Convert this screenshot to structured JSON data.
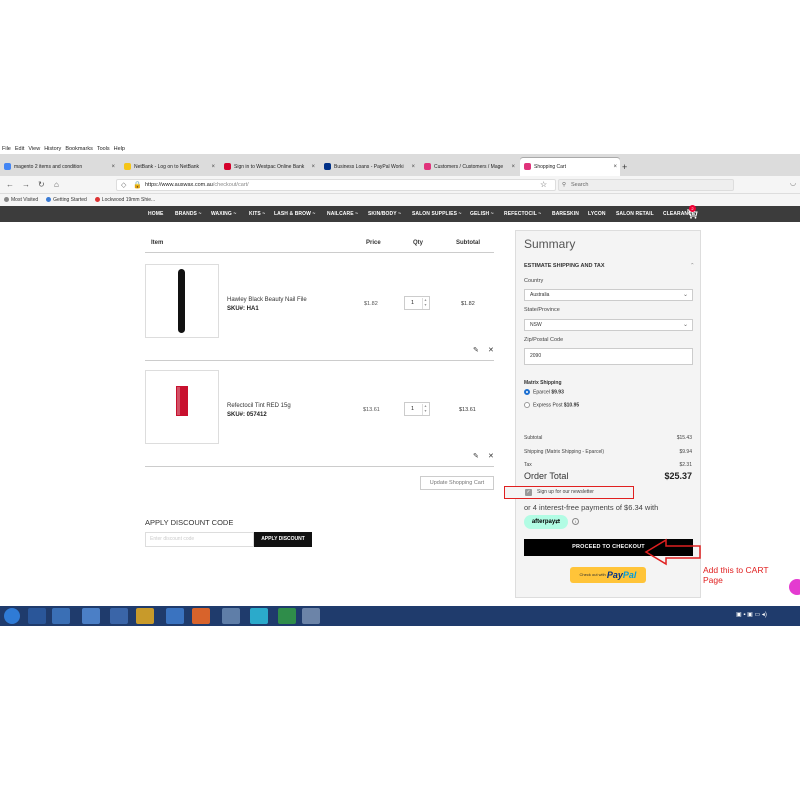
{
  "menu": [
    "File",
    "Edit",
    "View",
    "History",
    "Bookmarks",
    "Tools",
    "Help"
  ],
  "tabs": [
    {
      "label": "magento 2 items and condition",
      "color": "#4285f4"
    },
    {
      "label": "NetBank - Log on to NetBank",
      "color": "#f5c518"
    },
    {
      "label": "Sign in to Westpac Online Bank",
      "color": "#d5002b"
    },
    {
      "label": "Business Loans - PayPal Worki",
      "color": "#003087"
    },
    {
      "label": "Customers / Customers / Mage",
      "color": "#e0337b"
    },
    {
      "label": "Shopping Cart",
      "color": "#e0337b"
    }
  ],
  "nav": {
    "url_host": "https://www.auswax.com.au",
    "url_path": "/checkout/cart/",
    "search_placeholder": "Search"
  },
  "bookmarks": [
    "Most Visited",
    "Getting Started",
    "Lockwood 19mm Shie..."
  ],
  "site_nav": [
    "HOME",
    "BRANDS ~",
    "WAXING ~",
    "KITS ~",
    "LASH & BROW ~",
    "NAILCARE ~",
    "SKIN/BODY ~",
    "SALON SUPPLIES ~",
    "GELISH ~",
    "REFECTOCIL ~",
    "BARESKIN",
    "LYCON",
    "SALON RETAIL",
    "CLEARANCE"
  ],
  "cart_badge": "2",
  "cart": {
    "headers": {
      "item": "Item",
      "price": "Price",
      "qty": "Qty",
      "subtotal": "Subtotal"
    },
    "items": [
      {
        "name": "Hawley Black Beauty Nail File",
        "sku": "SKU#: HA1",
        "price": "$1.82",
        "qty": "1",
        "subtotal": "$1.82"
      },
      {
        "name": "Refectocil Tint RED 15g",
        "sku": "SKU#: 057412",
        "price": "$13.61",
        "qty": "1",
        "subtotal": "$13.61"
      }
    ],
    "update_label": "Update Shopping Cart",
    "discount_title": "APPLY DISCOUNT CODE",
    "discount_placeholder": "Enter discount code",
    "discount_button": "APPLY DISCOUNT"
  },
  "summary": {
    "title": "Summary",
    "estimate_label": "ESTIMATE SHIPPING AND TAX",
    "country_label": "Country",
    "country_value": "Australia",
    "state_label": "State/Province",
    "state_value": "NSW",
    "zip_label": "Zip/Postal Code",
    "zip_value": "2090",
    "shipping_method_title": "Matrix Shipping",
    "options": [
      {
        "name": "Eparcel",
        "price": "$9.93",
        "selected": true
      },
      {
        "name": "Express Post",
        "price": "$10.95",
        "selected": false
      }
    ],
    "totals": [
      {
        "label": "Subtotal",
        "value": "$15.43"
      },
      {
        "label": "Shipping (Matrix Shipping - Eparcel)",
        "value": "$9.94"
      },
      {
        "label": "Tax",
        "value": "$2.31"
      }
    ],
    "order_total_label": "Order Total",
    "order_total_value": "$25.37",
    "newsletter_label": "Sign up for our newsletter",
    "afterpay_text": "or 4 interest-free payments of $6.34 with",
    "afterpay_logo": "afterpay",
    "checkout_label": "PROCEED TO CHECKOUT",
    "paypal_prefix": "Check out with",
    "paypal_logo_a": "Pay",
    "paypal_logo_b": "Pal"
  },
  "annotation": {
    "line1": "Add this to CART",
    "line2": "Page",
    "color": "#e02020"
  }
}
